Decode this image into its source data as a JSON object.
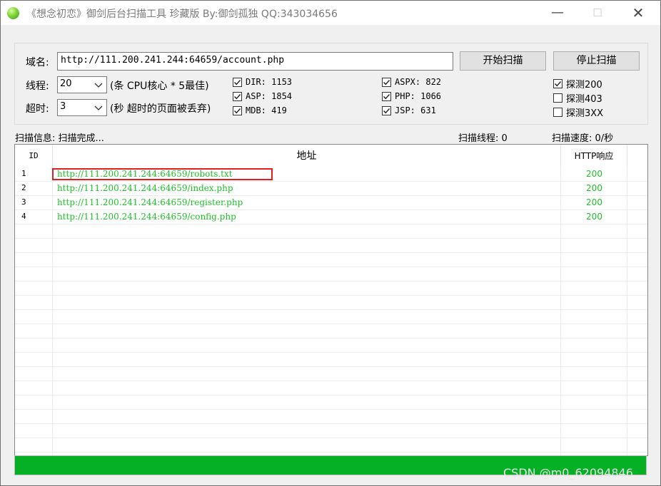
{
  "window": {
    "title": "《想念初恋》御剑后台扫描工具 珍藏版 By:御剑孤独 QQ:343034656",
    "min_label": "—",
    "max_label": "☐",
    "close_label": "✕"
  },
  "form": {
    "domain_label": "域名:",
    "domain_value": "http://111.200.241.244:64659/account.php",
    "threads_label": "线程:",
    "threads_value": "20",
    "threads_hint": "(条 CPU核心 * 5最佳)",
    "timeout_label": "超时:",
    "timeout_value": "3",
    "timeout_hint": "(秒 超时的页面被丢弃)",
    "start_button": "开始扫描",
    "stop_button": "停止扫描"
  },
  "dictionaries": [
    {
      "label": "DIR: 1153",
      "checked": true
    },
    {
      "label": "ASP: 1854",
      "checked": true
    },
    {
      "label": "MDB: 419",
      "checked": true
    },
    {
      "label": "ASPX: 822",
      "checked": true
    },
    {
      "label": "PHP: 1066",
      "checked": true
    },
    {
      "label": "JSP: 631",
      "checked": true
    }
  ],
  "probes": [
    {
      "label": "探测200",
      "checked": true
    },
    {
      "label": "探测403",
      "checked": false
    },
    {
      "label": "探测3XX",
      "checked": false
    }
  ],
  "status": {
    "info": "扫描信息: 扫描完成...",
    "threads": "扫描线程: 0",
    "speed": "扫描速度: 0/秒"
  },
  "table": {
    "headers": {
      "id": "ID",
      "address": "地址",
      "http": "HTTP响应"
    },
    "rows": [
      {
        "id": "1",
        "url": "http://111.200.241.244:64659/robots.txt",
        "code": "200"
      },
      {
        "id": "2",
        "url": "http://111.200.241.244:64659/index.php",
        "code": "200"
      },
      {
        "id": "3",
        "url": "http://111.200.241.244:64659/register.php",
        "code": "200"
      },
      {
        "id": "4",
        "url": "http://111.200.241.244:64659/config.php",
        "code": "200"
      }
    ]
  },
  "progress": {
    "fraction": 1.0
  },
  "watermark": "CSDN @m0_62094846",
  "colors": {
    "result_green": "#1fbf2a",
    "progress_green": "#06b025",
    "highlight_red": "#e02020"
  }
}
